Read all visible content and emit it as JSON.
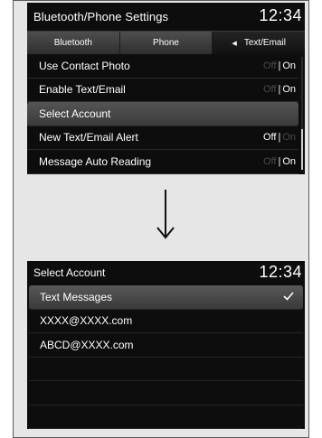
{
  "screen1": {
    "title": "Bluetooth/Phone Settings",
    "clock": "12:34",
    "tabs": [
      {
        "label": "Bluetooth"
      },
      {
        "label": "Phone"
      },
      {
        "label": "Text/Email"
      }
    ],
    "items": [
      {
        "label": "Use Contact Photo",
        "off": "Off",
        "on": "On",
        "state": "On"
      },
      {
        "label": "Enable Text/Email",
        "off": "Off",
        "on": "On",
        "state": "On"
      },
      {
        "label": "Select Account"
      },
      {
        "label": "New Text/Email Alert",
        "off": "Off",
        "on": "On",
        "state": "Off"
      },
      {
        "label": "Message Auto Reading",
        "off": "Off",
        "on": "On",
        "state": "On"
      }
    ],
    "separator": "|"
  },
  "screen2": {
    "title": "Select Account",
    "clock": "12:34",
    "items": [
      {
        "label": "Text Messages",
        "checked": true
      },
      {
        "label": "XXXX@XXXX.com"
      },
      {
        "label": "ABCD@XXXX.com"
      },
      {
        "label": ""
      },
      {
        "label": ""
      },
      {
        "label": ""
      }
    ]
  },
  "colors": {
    "screen_bg": "#0d0d0d",
    "highlight": "#4a4a4a",
    "dim_text": "#4a4a4a",
    "frame_bg": "#e6e6e6"
  },
  "icons": {
    "transition_arrow": "arrow-down-icon",
    "check": "checkmark-icon",
    "tab_indicator": "triangle-left-icon"
  }
}
